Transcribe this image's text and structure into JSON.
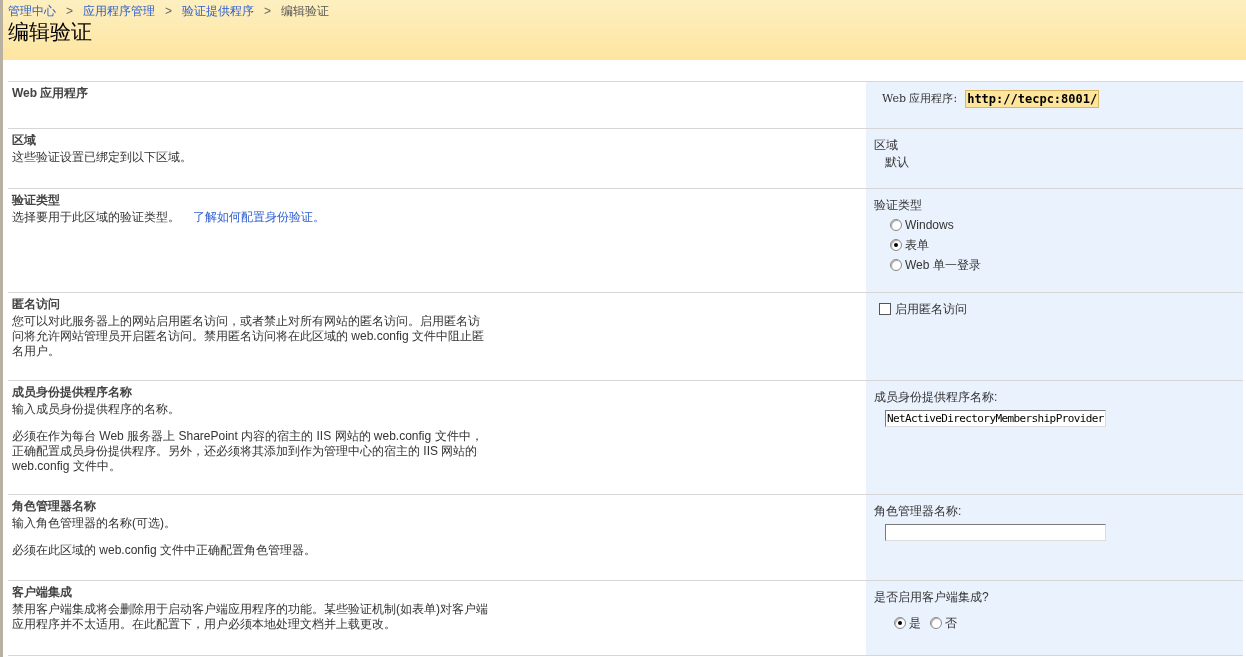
{
  "breadcrumb": [
    {
      "label": "管理中心",
      "link": true
    },
    {
      "label": "应用程序管理",
      "link": true
    },
    {
      "label": "验证提供程序",
      "link": true
    },
    {
      "label": "编辑验证",
      "link": false
    }
  ],
  "breadcrumb_separator": ">",
  "page_title": "编辑验证",
  "sections": [
    {
      "title": "Web 应用程序",
      "control": {
        "kind": "url",
        "label": "Web 应用程序:",
        "value": "http://tecpc:8001/"
      }
    },
    {
      "title": "区域",
      "description": [
        "这些验证设置已绑定到以下区域。"
      ],
      "control": {
        "kind": "text",
        "label": "区域",
        "value": "默认"
      }
    },
    {
      "title": "验证类型",
      "description": [
        "选择要用于此区域的验证类型。"
      ],
      "link": "了解如何配置身份验证。",
      "control": {
        "kind": "radio_list",
        "label": "验证类型",
        "options": [
          {
            "label": "Windows",
            "selected": false
          },
          {
            "label": "表单",
            "selected": true
          },
          {
            "label": "Web 单一登录",
            "selected": false
          }
        ]
      }
    },
    {
      "title": "匿名访问",
      "description": [
        "您可以对此服务器上的网站启用匿名访问，或者禁止对所有网站的匿名访问。启用匿名访问将允许网站管理员开启匿名访问。禁用匿名访问将在此区域的 web.config 文件中阻止匿名用户。"
      ],
      "control": {
        "kind": "checkbox",
        "label": "启用匿名访问",
        "checked": false
      }
    },
    {
      "title": "成员身份提供程序名称",
      "description": [
        "输入成员身份提供程序的名称。",
        "必须在作为每台 Web 服务器上 SharePoint 内容的宿主的 IIS 网站的 web.config 文件中，正确配置成员身份提供程序。另外，还必须将其添加到作为管理中心的宿主的 IIS 网站的 web.config 文件中。"
      ],
      "control": {
        "kind": "input",
        "label": "成员身份提供程序名称:",
        "value": "NetActiveDirectoryMembershipProvider"
      }
    },
    {
      "title": "角色管理器名称",
      "description": [
        "输入角色管理器的名称(可选)。",
        "必须在此区域的 web.config 文件中正确配置角色管理器。"
      ],
      "control": {
        "kind": "input",
        "label": "角色管理器名称:"
      }
    },
    {
      "title": "客户端集成",
      "description": [
        "禁用客户端集成将会删除用于启动客户端应用程序的功能。某些验证机制(如表单)对客户端应用程序并不太适用。在此配置下，用户必须本地处理文档并上载更改。"
      ],
      "control": {
        "kind": "radio_inline",
        "label": "是否启用客户端集成?",
        "options": [
          {
            "label": "是",
            "selected": true
          },
          {
            "label": "否",
            "selected": false
          }
        ]
      }
    }
  ]
}
